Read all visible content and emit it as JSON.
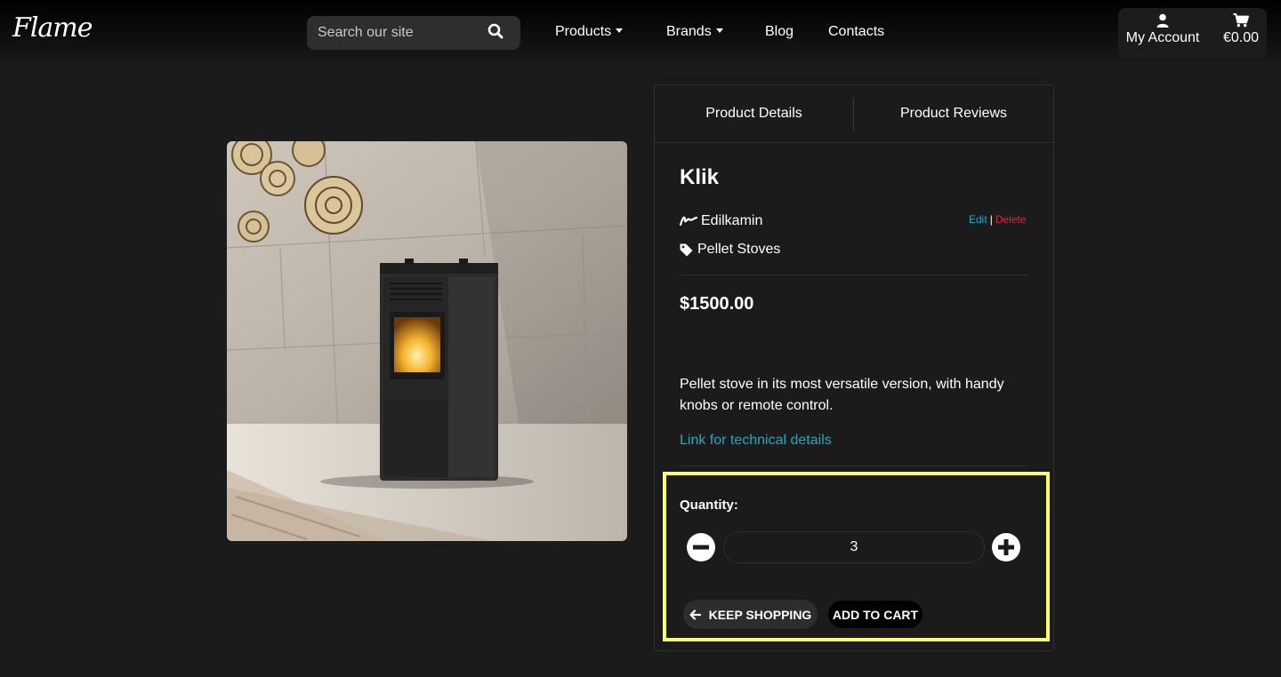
{
  "header": {
    "logo_text": "Flame",
    "search": {
      "placeholder": "Search our site"
    },
    "nav": {
      "products": "Products",
      "brands": "Brands",
      "blog": "Blog",
      "contacts": "Contacts"
    },
    "account": {
      "label": "My Account"
    },
    "cart": {
      "total": "€0.00"
    }
  },
  "product": {
    "image_alt": "Klik pellet stove in a room",
    "tabs": [
      "Product Details",
      "Product Reviews"
    ],
    "name": "Klik",
    "brand": "Edilkamin",
    "category": "Pellet Stoves",
    "admin": {
      "edit": "Edit",
      "separator": "|",
      "delete": "Delete"
    },
    "price": "$1500.00",
    "description": "Pellet stove in its most versatile version, with handy knobs or remote control.",
    "tech_link": "Link for technical details"
  },
  "purchase": {
    "quantity_label": "Quantity:",
    "quantity": "3",
    "keep_shopping": "KEEP SHOPPING",
    "add_to_cart": "ADD TO CART"
  },
  "colors": {
    "background": "#1b1b1c",
    "link": "#1fa9c1",
    "delete": "#e0243f",
    "highlight": "#ffff66"
  }
}
